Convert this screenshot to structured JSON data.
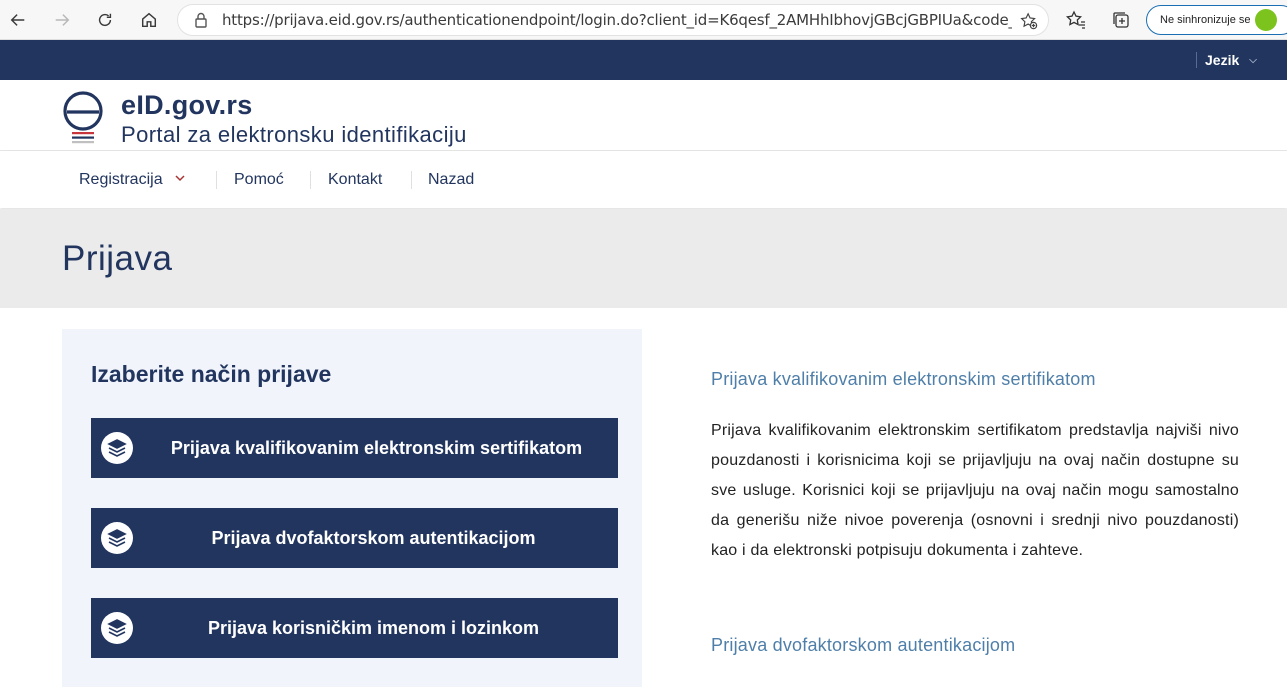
{
  "browser": {
    "url": "https://prijava.eid.gov.rs/authenticationendpoint/login.do?client_id=K6qesf_2AMHhIbhovjGBcjGBPIUa&code_...",
    "sync_label": "Ne sinhronizuje se"
  },
  "topbar": {
    "language_label": "Jezik"
  },
  "header": {
    "site_name": "eID.gov.rs",
    "site_subtitle": "Portal za elektronsku identifikaciju"
  },
  "nav": {
    "items": [
      {
        "label": "Registracija"
      },
      {
        "label": "Pomoć"
      },
      {
        "label": "Kontakt"
      },
      {
        "label": "Nazad"
      }
    ]
  },
  "page": {
    "title": "Prijava"
  },
  "login_panel": {
    "title": "Izaberite način prijave",
    "options": [
      {
        "label": "Prijava kvalifikovanim elektronskim sertifikatom"
      },
      {
        "label": "Prijava dvofaktorskom autentikacijom"
      },
      {
        "label": "Prijava korisničkim imenom i lozinkom"
      }
    ]
  },
  "info": {
    "sections": [
      {
        "heading": "Prijava kvalifikovanim elektronskim sertifikatom",
        "text": "Prijava kvalifikovanim elektronskim sertifikatom predstavlja najviši nivo pouzdanosti i korisnicima koji se prijavljuju na ovaj način dostupne su sve usluge. Korisnici koji se prijavljuju na ovaj način mogu samostalno da generišu niže nivoe poverenja (osnovni i srednji nivo pouzdanosti) kao i da elektronski potpisuju dokumenta i zahteve."
      },
      {
        "heading": "Prijava dvofaktorskom autentikacijom"
      }
    ]
  },
  "colors": {
    "brand_navy": "#22355f",
    "panel_bg": "#f1f5fb",
    "title_band": "#ebebeb",
    "info_heading": "#4f7fa9"
  }
}
